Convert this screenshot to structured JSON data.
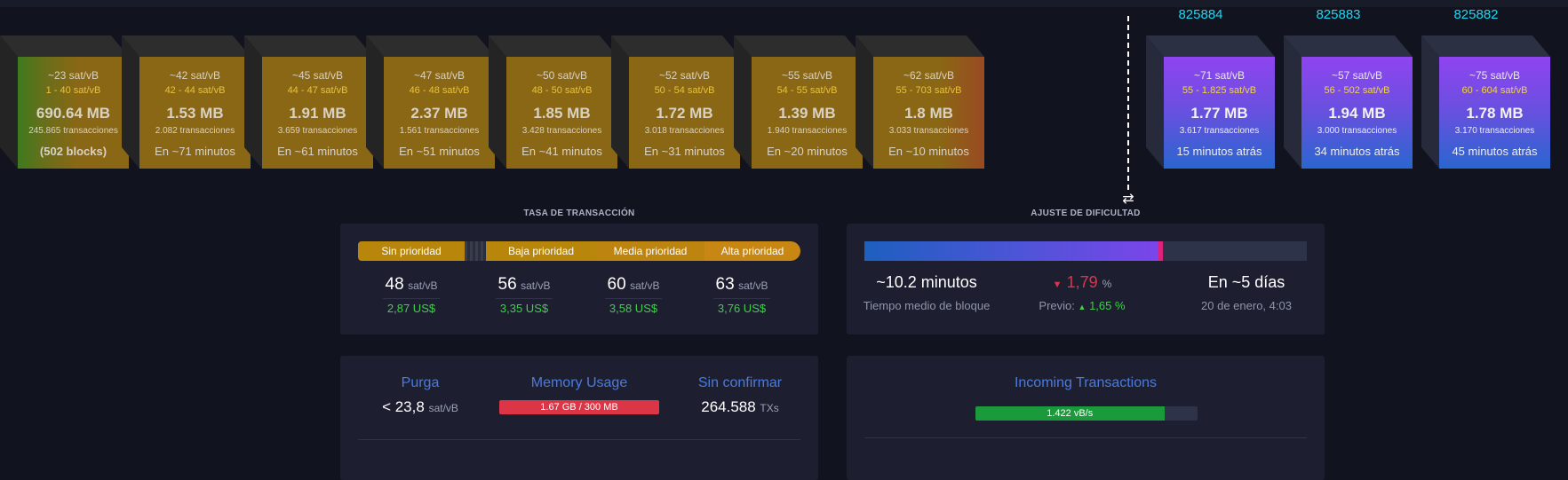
{
  "mempool_blocks": [
    {
      "fee": "~23 sat/vB",
      "range": "1 - 40 sat/vB",
      "size": "690.64 MB",
      "tx": "245.865 transacciones",
      "time": "(502 blocks)"
    },
    {
      "fee": "~42 sat/vB",
      "range": "42 - 44 sat/vB",
      "size": "1.53 MB",
      "tx": "2.082 transacciones",
      "time": "En ~71 minutos"
    },
    {
      "fee": "~45 sat/vB",
      "range": "44 - 47 sat/vB",
      "size": "1.91 MB",
      "tx": "3.659 transacciones",
      "time": "En ~61 minutos"
    },
    {
      "fee": "~47 sat/vB",
      "range": "46 - 48 sat/vB",
      "size": "2.37 MB",
      "tx": "1.561 transacciones",
      "time": "En ~51 minutos"
    },
    {
      "fee": "~50 sat/vB",
      "range": "48 - 50 sat/vB",
      "size": "1.85 MB",
      "tx": "3.428 transacciones",
      "time": "En ~41 minutos"
    },
    {
      "fee": "~52 sat/vB",
      "range": "50 - 54 sat/vB",
      "size": "1.72 MB",
      "tx": "3.018 transacciones",
      "time": "En ~31 minutos"
    },
    {
      "fee": "~55 sat/vB",
      "range": "54 - 55 sat/vB",
      "size": "1.39 MB",
      "tx": "1.940 transacciones",
      "time": "En ~20 minutos"
    },
    {
      "fee": "~62 sat/vB",
      "range": "55 - 703 sat/vB",
      "size": "1.8 MB",
      "tx": "3.033 transacciones",
      "time": "En ~10 minutos"
    }
  ],
  "mined_blocks": [
    {
      "height": "825884",
      "fee": "~71 sat/vB",
      "range": "55 - 1.825 sat/vB",
      "size": "1.77 MB",
      "tx": "3.617 transacciones",
      "time": "15 minutos atrás"
    },
    {
      "height": "825883",
      "fee": "~57 sat/vB",
      "range": "56 - 502 sat/vB",
      "size": "1.94 MB",
      "tx": "3.000 transacciones",
      "time": "34 minutos atrás"
    },
    {
      "height": "825882",
      "fee": "~75 sat/vB",
      "range": "60 - 604 sat/vB",
      "size": "1.78 MB",
      "tx": "3.170 transacciones",
      "time": "45 minutos atrás"
    }
  ],
  "divider_icon": "swap-arrows-icon",
  "fees": {
    "title": "TASA DE TRANSACCIÓN",
    "labels": {
      "none": "Sin prioridad",
      "low": "Baja prioridad",
      "medium": "Media prioridad",
      "high": "Alta prioridad"
    },
    "low": {
      "value": "48",
      "unit": "sat/vB",
      "usd": "2,87 US$"
    },
    "medium": {
      "value": "56",
      "unit": "sat/vB",
      "usd": "3,35 US$"
    },
    "medium2": {
      "value": "60",
      "unit": "sat/vB",
      "usd": "3,58 US$"
    },
    "high": {
      "value": "63",
      "unit": "sat/vB",
      "usd": "3,76 US$"
    }
  },
  "difficulty": {
    "title": "AJUSTE DE DIFICULTAD",
    "progress": 0.67,
    "avg_block_time": "~10.2 minutos",
    "avg_block_label": "Tiempo medio de bloque",
    "change": "1,79",
    "change_unit": "%",
    "previous_label": "Previo:",
    "previous_value": "1,65",
    "previous_unit": "%",
    "eta": "En ~5 días",
    "eta_date": "20 de enero, 4:03"
  },
  "mempool_stats": {
    "purge_title": "Purga",
    "purge_value": "< 23,8",
    "purge_unit": "sat/vB",
    "memory_title": "Memory Usage",
    "memory_value": "1.67 GB / 300 MB",
    "unconfirmed_title": "Sin confirmar",
    "unconfirmed_value": "264.588",
    "unconfirmed_unit": "TXs"
  },
  "incoming": {
    "title": "Incoming Transactions",
    "rate": "1.422 vB/s",
    "fill_fraction": 0.85
  },
  "colors": {
    "background": "#11131f",
    "panel": "#1d1f31",
    "height_link": "#1bd8f4",
    "fee_bar": "#b8860b",
    "usd_green": "#3fcf4a",
    "change_red": "#e0344a",
    "accent_title": "#4a7bdc",
    "memory_bar": "#dc3545",
    "incoming_bar": "#1a9a3a"
  }
}
